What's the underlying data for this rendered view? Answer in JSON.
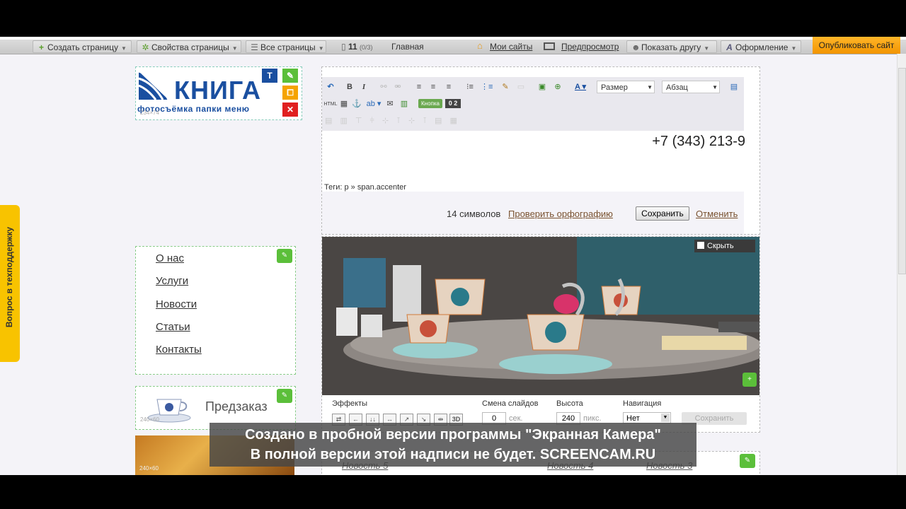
{
  "toolbar": {
    "create_page": "Создать страницу",
    "page_props": "Свойства страницы",
    "all_pages": "Все страницы",
    "page_num": "11",
    "page_count": "(0/3)",
    "current_page": "Главная",
    "my_sites": "Мои сайты",
    "preview": "Предпросмотр",
    "show_friend": "Показать другу",
    "design": "Оформление",
    "publish": "Опубликовать сайт"
  },
  "support_tab": "Вопрос в техподдержку",
  "logo": {
    "word": "КНИГА",
    "subtitle": "фотосъёмка  папки меню",
    "size": "234×74",
    "badge": "T"
  },
  "menu": {
    "items": [
      "О нас",
      "Услуги",
      "Новости",
      "Статьи",
      "Контакты"
    ]
  },
  "preorder": {
    "label": "Предзаказ",
    "size": "240×60"
  },
  "tea_size": "240×60",
  "editor": {
    "size_select": "Размер",
    "para_select": "Абзац",
    "button_label": "Кнопка",
    "html_label": "HTML",
    "content": "+7 (343) 213-9",
    "tags": "Теги: p » span.accenter",
    "chars": "14 символов",
    "spellcheck": "Проверить орфографию",
    "save": "Сохранить",
    "cancel": "Отменить"
  },
  "slider": {
    "hide": "Скрыть",
    "effects_label": "Эффекты",
    "change_label": "Смена слайдов",
    "change_value": "0",
    "change_unit": "сек.",
    "height_label": "Высота",
    "height_value": "240",
    "height_unit": "пикс.",
    "nav_label": "Навигация",
    "nav_value": "Нет",
    "save": "Сохранить"
  },
  "news": [
    "Новость 5",
    "Новость 4",
    "Новость 3"
  ],
  "watermark": {
    "line1": "Создано в пробной версии программы \"Экранная Камера\"",
    "line2": "В полной версии этой надписи не будет. SCREENCAM.RU"
  },
  "colors": {
    "publish": "#f29400",
    "support": "#f8c300",
    "edit_green": "#5bbf3a",
    "logo_blue": "#1a4fa0"
  }
}
